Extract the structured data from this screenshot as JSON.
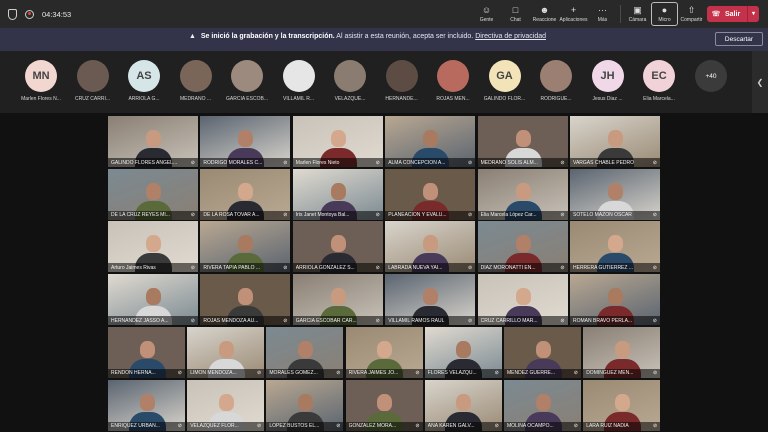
{
  "topbar": {
    "timer": "04:34:53",
    "actions": [
      {
        "label": "Gente",
        "icon": "people-icon"
      },
      {
        "label": "Chat",
        "icon": "chat-icon"
      },
      {
        "label": "Reaccione",
        "icon": "reaction-icon"
      },
      {
        "label": "Aplicaciones",
        "icon": "apps-icon"
      },
      {
        "label": "Más",
        "icon": "more-icon"
      }
    ],
    "media": [
      {
        "label": "Cámara",
        "icon": "camera-icon"
      },
      {
        "label": "Micro",
        "icon": "microphone-icon"
      },
      {
        "label": "Compartir",
        "icon": "share-icon"
      }
    ],
    "leave_label": "Salir",
    "colors": {
      "leave": "#c4314b",
      "bar": "#292929"
    }
  },
  "banner": {
    "bold": "Se inició la grabación y la transcripción.",
    "text": "Al asistir a esta reunión, acepta ser incluido.",
    "link": "Directiva de privacidad",
    "dismiss": "Descartar"
  },
  "strip": {
    "participants": [
      {
        "name": "Marlen Flores N...",
        "initials": "MN",
        "color": "#f2d6d0"
      },
      {
        "name": "CRUZ CARRI...",
        "initials": "",
        "color": "#6b5a52"
      },
      {
        "name": "ARRIOLA G...",
        "initials": "AS",
        "color": "#d6e6e8"
      },
      {
        "name": "MEDRANO ...",
        "initials": "",
        "color": "#7a6658"
      },
      {
        "name": "GARCIA ESCOB...",
        "initials": "",
        "color": "#9c8a7e"
      },
      {
        "name": "VILLAMIL R...",
        "initials": "",
        "color": "#e6e6e6"
      },
      {
        "name": "VELAZQUE...",
        "initials": "",
        "color": "#8a7c70"
      },
      {
        "name": "HERNANDE...",
        "initials": "",
        "color": "#5c4c44"
      },
      {
        "name": "ROJAS MEN...",
        "initials": "",
        "color": "#b86a5e"
      },
      {
        "name": "GALINDO FLOR...",
        "initials": "GA",
        "color": "#f3e3b8"
      },
      {
        "name": "RODRIGUE...",
        "initials": "",
        "color": "#9a7f72"
      },
      {
        "name": "Jesus Diaz ...",
        "initials": "JH",
        "color": "#f0d8e8"
      },
      {
        "name": "Elia Marcela...",
        "initials": "EC",
        "color": "#f0d2d8"
      }
    ],
    "more": "+40"
  },
  "tiles": [
    "GALINDO FLORES ANGEL...",
    "RODRIGO MORALES C...",
    "Marlen Flores Nieto",
    "ALMA CONCEPCION A...",
    "MEDRANO SOLIS ALM...",
    "VARGAS CHABLE PEDRO",
    "DE LA CRUZ REYES MI...",
    "DE LA ROSA TOVAR A...",
    "Iris Janet Montoya Bal...",
    "PLANEACIÓN Y EVALU...",
    "Elia Marcela López Car...",
    "SOTELO MAZON OSCAR",
    "Arturo Jaimes Rivas",
    "RIVERA TAPIA PABLO ...",
    "ARRIOLA GONZALEZ S...",
    "LABRADA NUEVA YAI...",
    "DIAZ MORONATTI EN...",
    "HERRERA GUTIERREZ ...",
    "HERNANDEZ JASSO A...",
    "ROJAS MENDOZA AU...",
    "GARCIA ESCOBAR CAR...",
    "VILLAMIL RAMOS RAUL",
    "CRUZ CARRILLO MAR...",
    "ROMAN BRAVO PERLA...",
    "RENDON HERNA...",
    "LIMON MENDOZA...",
    "MORALES GOMEZ...",
    "RIVERA JAIMES JO...",
    "FLORES VELAZQU...",
    "MENDEZ GUERRE...",
    "DOMINGUEZ MEN...",
    "ENRIQUEZ URBAN...",
    "VELAZQUEZ FLOR...",
    "LOPEZ BUSTOS EL...",
    "GONZALEZ MORA...",
    "ANA KAREN GALV...",
    "MOLINA OCAMPO...",
    "LARA RUIZ NADIA"
  ]
}
